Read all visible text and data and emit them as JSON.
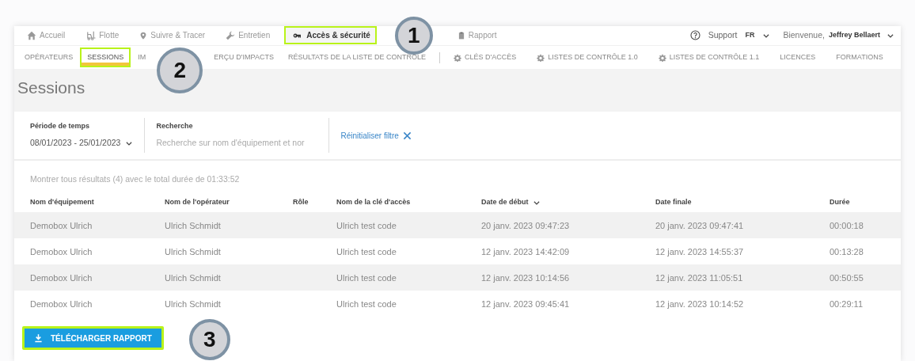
{
  "main_nav": [
    {
      "label": "Accueil",
      "selected": false,
      "highlighted": false
    },
    {
      "label": "Flotte",
      "selected": false,
      "highlighted": false
    },
    {
      "label": "Suivre & Tracer",
      "selected": false,
      "highlighted": false
    },
    {
      "label": "Entretien",
      "selected": false,
      "highlighted": false
    },
    {
      "label": "Accès & sécurité",
      "selected": true,
      "highlighted": true
    },
    {
      "label": "Rapport",
      "selected": false,
      "highlighted": false
    }
  ],
  "support": "Support",
  "language": "FR",
  "welcome": "Bienvenue,",
  "user": "Jeffrey Bellaert",
  "sub_tabs": [
    {
      "label": "OPÉRATEURS",
      "kind": "plain",
      "selected": false,
      "highlighted": false
    },
    {
      "label": "SESSIONS",
      "kind": "plain",
      "selected": true,
      "highlighted": true
    },
    {
      "label": "IM",
      "kind": "plain",
      "selected": false,
      "highlighted": false
    },
    {
      "label": "ERÇU D'IMPACTS",
      "kind": "plain",
      "selected": false,
      "highlighted": false
    },
    {
      "label": "RÉSULTATS DE LA LISTE DE CONTRÔLE",
      "kind": "plain",
      "selected": false,
      "highlighted": false
    },
    {
      "label": "CLÉS D'ACCÈS",
      "kind": "settings",
      "selected": false,
      "highlighted": false
    },
    {
      "label": "LISTES DE CONTRÔLE 1.0",
      "kind": "settings",
      "selected": false,
      "highlighted": false
    },
    {
      "label": "LISTES DE CONTRÔLE 1.1",
      "kind": "settings",
      "selected": false,
      "highlighted": false
    },
    {
      "label": "LICENCES",
      "kind": "plain",
      "selected": false,
      "highlighted": false
    },
    {
      "label": "FORMATIONS",
      "kind": "plain",
      "selected": false,
      "highlighted": false
    }
  ],
  "page_title": "Sessions",
  "filters": {
    "period_label": "Période de temps",
    "period_value": "08/01/2023 - 25/01/2023",
    "search_label": "Recherche",
    "search_placeholder": "Recherche sur nom d'équipement et nor",
    "reset": "Réinitialiser filtre"
  },
  "summary": "Montrer tous résultats (4) avec le total durée de 01:33:52",
  "table": {
    "columns": [
      {
        "label": "Nom d'équipement",
        "sorted": false
      },
      {
        "label": "Nom de l'opérateur",
        "sorted": false
      },
      {
        "label": "Rôle",
        "sorted": false
      },
      {
        "label": "Nom de la clé d'accès",
        "sorted": false
      },
      {
        "label": "Date de début",
        "sorted": true
      },
      {
        "label": "Date finale",
        "sorted": false
      },
      {
        "label": "Durée",
        "sorted": false
      }
    ],
    "rows": [
      [
        "Demobox Ulrich",
        "Ulrich Schmidt",
        null,
        "Ulrich test code",
        "20 janv. 2023 09:47:23",
        "20 janv. 2023 09:47:41",
        "00:00:18"
      ],
      [
        "Demobox Ulrich",
        "Ulrich Schmidt",
        null,
        "Ulrich test code",
        "12 janv. 2023 14:42:09",
        "12 janv. 2023 14:55:37",
        "00:13:28"
      ],
      [
        "Demobox Ulrich",
        "Ulrich Schmidt",
        null,
        "Ulrich test code",
        "12 janv. 2023 10:14:56",
        "12 janv. 2023 11:05:51",
        "00:50:55"
      ],
      [
        "Demobox Ulrich",
        "Ulrich Schmidt",
        null,
        "Ulrich test code",
        "12 janv. 2023 09:45:41",
        "12 janv. 2023 10:14:52",
        "00:29:11"
      ]
    ]
  },
  "download_button": {
    "label": "TÉLÉCHARGER RAPPORT",
    "highlighted": true
  },
  "callouts": [
    "1",
    "2",
    "3"
  ]
}
